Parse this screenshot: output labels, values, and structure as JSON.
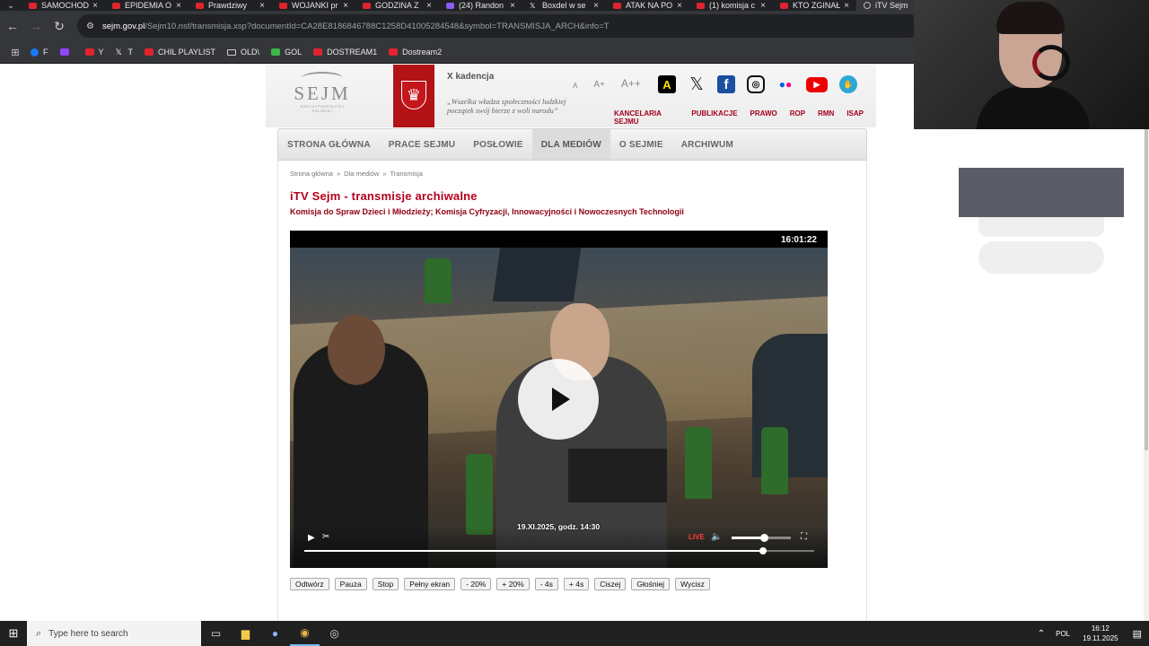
{
  "tabs": [
    {
      "label": "SAMOCHOD",
      "icon": "youtube-icon"
    },
    {
      "label": "EPIDEMIA O",
      "icon": "youtube-icon"
    },
    {
      "label": "Prawdziwy",
      "icon": "youtube-icon"
    },
    {
      "label": "WOJANKI pr",
      "icon": "youtube-icon"
    },
    {
      "label": "GODZINA Z",
      "icon": "youtube-icon"
    },
    {
      "label": "(24) Randon",
      "icon": "twitch-icon"
    },
    {
      "label": "Boxdel w se",
      "icon": "x-icon"
    },
    {
      "label": "ATAK NA PO",
      "icon": "youtube-icon"
    },
    {
      "label": "(1) komisja c",
      "icon": "youtube-icon"
    },
    {
      "label": "KTO ZGINAŁ",
      "icon": "youtube-icon"
    },
    {
      "label": "iTV Sejm",
      "icon": "globe-icon",
      "active": true
    }
  ],
  "address": {
    "host": "sejm.gov.pl",
    "path": "/Sejm10.nsf/transmisja.xsp?documentId=CA28E8186846788C1258D41005284548&symbol=TRANSMISJA_ARCH&info=T"
  },
  "bookmarks": [
    {
      "label": "F",
      "icon": "facebook-icon"
    },
    {
      "label": "",
      "icon": "twitch-icon"
    },
    {
      "label": "Y",
      "icon": "youtube-icon"
    },
    {
      "label": "T",
      "icon": "x-icon"
    },
    {
      "label": "CHIL PLAYLIST",
      "icon": "youtube-icon"
    },
    {
      "label": "OLD\\",
      "icon": "folder-icon"
    },
    {
      "label": "GOL",
      "icon": "gol-icon"
    },
    {
      "label": "DOSTREAM1",
      "icon": "youtube-icon"
    },
    {
      "label": "Dostream2",
      "icon": "youtube-icon"
    }
  ],
  "header": {
    "logo_word": "SEJM",
    "logo_sub": "RZECZYPOSPOLITEJ POLSKIEJ",
    "kadencja": "X kadencja",
    "quote": "„Wszelka władza społeczności ludzkiej początek swój bierze z woli narodu”",
    "font_sizes": [
      "A",
      "A+",
      "A++"
    ],
    "top_links": [
      "KANCELARIA SEJMU",
      "PUBLIKACJE",
      "PRAWO",
      "ROP",
      "RMN",
      "ISAP"
    ]
  },
  "nav": [
    {
      "label": "STRONA GŁÓWNA"
    },
    {
      "label": "PRACE SEJMU"
    },
    {
      "label": "POSŁOWIE"
    },
    {
      "label": "DLA MEDIÓW",
      "active": true
    },
    {
      "label": "O SEJMIE"
    },
    {
      "label": "ARCHIWUM"
    }
  ],
  "breadcrumb": [
    "Strona główna",
    "»",
    "Dla mediów",
    "»",
    "Transmisja"
  ],
  "title": "iTV Sejm - transmisje archiwalne",
  "subtitle": "Komisja do Spraw Dzieci i Młodzieży; Komisja Cyfryzacji, Innowacyjności i Nowoczesnych Technologii",
  "player": {
    "clock": "16:01:22",
    "stamp": "19.XI.2025, godz. 14:30",
    "live_label": "LIVE",
    "volume": 0.55,
    "progress": 0.9
  },
  "buttons": [
    "Odtwórz",
    "Pauza",
    "Stop",
    "Pełny ekran",
    "- 20%",
    "+ 20%",
    "- 4s",
    "+ 4s",
    "Ciszej",
    "Głośniej",
    "Wycisz"
  ],
  "taskbar": {
    "search_placeholder": "Type here to search",
    "lang": "POL",
    "time": "16:12",
    "date": "19.11.2025"
  }
}
